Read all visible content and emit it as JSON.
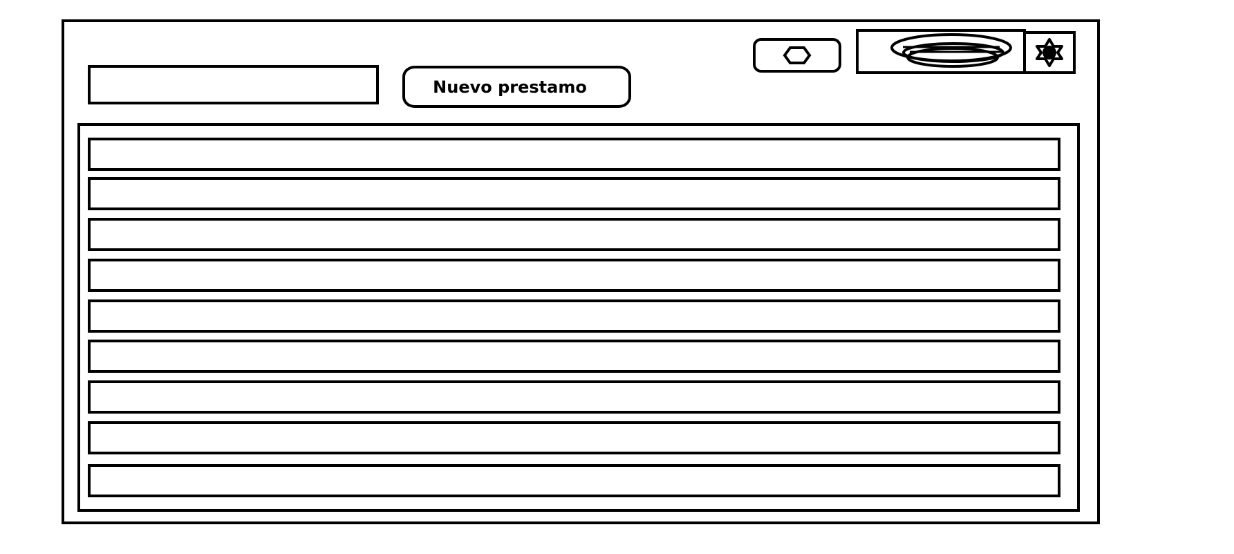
{
  "toolbar": {
    "new_loan_label": "Nuevo prestamo",
    "icon_button_icon": "hexagon-icon",
    "profile_icon": "scribbled-ellipse-icon",
    "settings_icon": "gear-icon"
  },
  "list": {
    "rows": [
      "",
      "",
      "",
      "",
      "",
      "",
      "",
      "",
      ""
    ]
  },
  "colors": {
    "stroke": "#000000",
    "background": "#ffffff"
  }
}
